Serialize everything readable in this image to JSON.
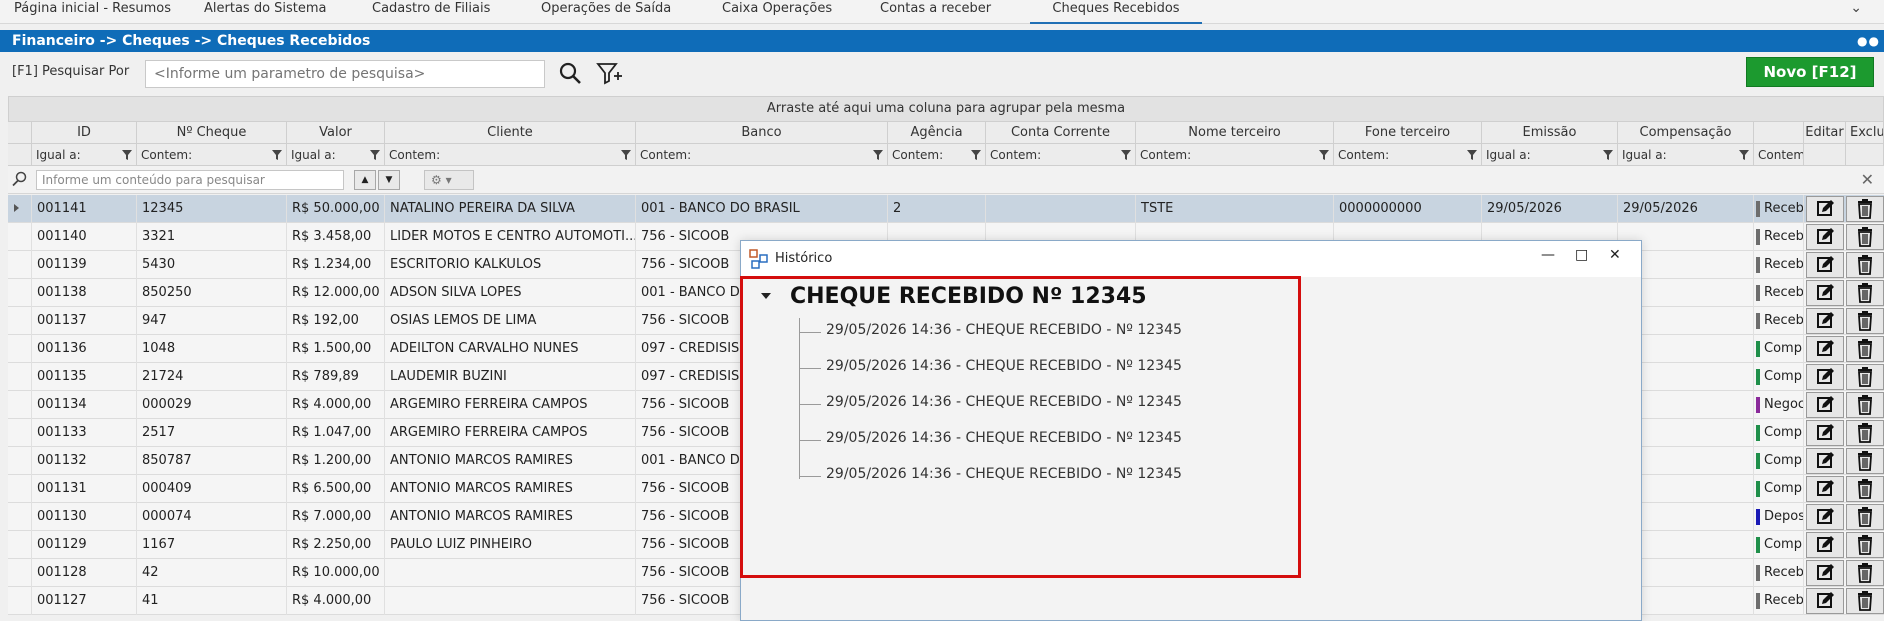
{
  "tabs": [
    {
      "label": "Página inicial - Resumos",
      "active": false
    },
    {
      "label": "Alertas do Sistema",
      "active": false
    },
    {
      "label": "Cadastro de Filiais",
      "active": false
    },
    {
      "label": "Operações de Saída",
      "active": false
    },
    {
      "label": "Caixa Operações",
      "active": false
    },
    {
      "label": "Contas a receber",
      "active": false
    },
    {
      "label": "Cheques Recebidos",
      "active": true
    }
  ],
  "breadcrumb": "Financeiro -> Cheques -> Cheques Recebidos",
  "search": {
    "label": "[F1] Pesquisar Por",
    "placeholder": "<Informe um parametro de pesquisa>"
  },
  "new_button": "Novo [F12]",
  "group_bar": "Arraste até aqui uma coluna para agrupar pela mesma",
  "columns": [
    "ID",
    "Nº Cheque",
    "Valor",
    "Cliente",
    "Banco",
    "Agência",
    "Conta Corrente",
    "Nome terceiro",
    "Fone terceiro",
    "Emissão",
    "Compensação",
    "",
    "Editar",
    "Excluir"
  ],
  "filters": [
    "Igual a:",
    "Contem:",
    "Igual a:",
    "Contem:",
    "Contem:",
    "Contem:",
    "Contem:",
    "Contem:",
    "Contem:",
    "Igual a:",
    "Igual a:",
    "Contem"
  ],
  "grid_search_placeholder": "Informe um conteúdo para pesquisar",
  "colors": {
    "accent": "#0f6cb8",
    "new_button": "#1c9a2f",
    "highlight": "#d40d0d",
    "status_gray": "#6d6d6d",
    "status_green": "#1f8f4a",
    "status_purple": "#8a2a9a",
    "status_blue": "#1a1ab5"
  },
  "rows": [
    {
      "id": "001141",
      "cheque": "12345",
      "valor": "R$ 50.000,00",
      "cliente": "NATALINO PEREIRA DA SILVA",
      "banco": "001 - BANCO DO BRASIL",
      "agencia": "2",
      "conta": "",
      "terceiro": "TSTE",
      "fone": "0000000000",
      "emissao": "29/05/2026",
      "compensacao": "29/05/2026",
      "situacao": "Receb",
      "status_color": "#6d6d6d",
      "selected": true
    },
    {
      "id": "001140",
      "cheque": "3321",
      "valor": "R$ 3.458,00",
      "cliente": "LIDER MOTOS E CENTRO AUTOMOTI...",
      "banco": "756 - SICOOB",
      "agencia": "",
      "conta": "",
      "terceiro": "",
      "fone": "",
      "emissao": "",
      "compensacao": "",
      "situacao": "Receb",
      "status_color": "#6d6d6d"
    },
    {
      "id": "001139",
      "cheque": "5430",
      "valor": "R$ 1.234,00",
      "cliente": "ESCRITORIO KALKULOS",
      "banco": "756 - SICOOB",
      "agencia": "",
      "conta": "",
      "terceiro": "",
      "fone": "",
      "emissao": "",
      "compensacao": "",
      "situacao": "Receb",
      "status_color": "#6d6d6d"
    },
    {
      "id": "001138",
      "cheque": "850250",
      "valor": "R$ 12.000,00",
      "cliente": "ADSON SILVA LOPES",
      "banco": "001 - BANCO DO",
      "agencia": "",
      "conta": "",
      "terceiro": "",
      "fone": "",
      "emissao": "",
      "compensacao": "",
      "situacao": "Receb",
      "status_color": "#6d6d6d"
    },
    {
      "id": "001137",
      "cheque": "947",
      "valor": "R$ 192,00",
      "cliente": "OSIAS LEMOS DE LIMA",
      "banco": "756 - SICOOB",
      "agencia": "",
      "conta": "",
      "terceiro": "",
      "fone": "",
      "emissao": "",
      "compensacao": "",
      "situacao": "Receb",
      "status_color": "#6d6d6d"
    },
    {
      "id": "001136",
      "cheque": "1048",
      "valor": "R$ 1.500,00",
      "cliente": "ADEILTON CARVALHO NUNES",
      "banco": "097 - CREDISIS",
      "agencia": "",
      "conta": "",
      "terceiro": "",
      "fone": "",
      "emissao": "",
      "compensacao": "",
      "situacao": "Comp",
      "status_color": "#1f8f4a"
    },
    {
      "id": "001135",
      "cheque": "21724",
      "valor": "R$ 789,89",
      "cliente": "LAUDEMIR BUZINI",
      "banco": "097 - CREDISIS",
      "agencia": "",
      "conta": "",
      "terceiro": "",
      "fone": "",
      "emissao": "",
      "compensacao": "",
      "situacao": "Comp",
      "status_color": "#1f8f4a"
    },
    {
      "id": "001134",
      "cheque": "000029",
      "valor": "R$ 4.000,00",
      "cliente": "ARGEMIRO FERREIRA CAMPOS",
      "banco": "756 - SICOOB",
      "agencia": "",
      "conta": "",
      "terceiro": "",
      "fone": "",
      "emissao": "",
      "compensacao": "",
      "situacao": "Negoc",
      "status_color": "#8a2a9a"
    },
    {
      "id": "001133",
      "cheque": "2517",
      "valor": "R$ 1.047,00",
      "cliente": "ARGEMIRO FERREIRA CAMPOS",
      "banco": "756 - SICOOB",
      "agencia": "",
      "conta": "",
      "terceiro": "",
      "fone": "",
      "emissao": "",
      "compensacao": "",
      "situacao": "Comp",
      "status_color": "#1f8f4a"
    },
    {
      "id": "001132",
      "cheque": "850787",
      "valor": "R$ 1.200,00",
      "cliente": "ANTONIO MARCOS RAMIRES",
      "banco": "001 - BANCO DO",
      "agencia": "",
      "conta": "",
      "terceiro": "",
      "fone": "",
      "emissao": "",
      "compensacao": "",
      "situacao": "Comp",
      "status_color": "#1f8f4a"
    },
    {
      "id": "001131",
      "cheque": "000409",
      "valor": "R$ 6.500,00",
      "cliente": "ANTONIO MARCOS RAMIRES",
      "banco": "756 - SICOOB",
      "agencia": "",
      "conta": "",
      "terceiro": "",
      "fone": "",
      "emissao": "",
      "compensacao": "",
      "situacao": "Comp",
      "status_color": "#1f8f4a"
    },
    {
      "id": "001130",
      "cheque": "000074",
      "valor": "R$ 7.000,00",
      "cliente": "ANTONIO MARCOS RAMIRES",
      "banco": "756 - SICOOB",
      "agencia": "",
      "conta": "",
      "terceiro": "",
      "fone": "",
      "emissao": "",
      "compensacao": "",
      "situacao": "Depos",
      "status_color": "#1a1ab5"
    },
    {
      "id": "001129",
      "cheque": "1167",
      "valor": "R$ 2.250,00",
      "cliente": "PAULO LUIZ PINHEIRO",
      "banco": "756 - SICOOB",
      "agencia": "",
      "conta": "",
      "terceiro": "",
      "fone": "",
      "emissao": "",
      "compensacao": "",
      "situacao": "Comp",
      "status_color": "#1f8f4a"
    },
    {
      "id": "001128",
      "cheque": "42",
      "valor": "R$ 10.000,00",
      "cliente": "",
      "banco": "756 - SICOOB",
      "agencia": "",
      "conta": "",
      "terceiro": "",
      "fone": "",
      "emissao": "",
      "compensacao": "",
      "situacao": "Receb",
      "status_color": "#6d6d6d"
    },
    {
      "id": "001127",
      "cheque": "41",
      "valor": "R$ 4.000,00",
      "cliente": "",
      "banco": "756 - SICOOB",
      "agencia": "",
      "conta": "",
      "terceiro": "",
      "fone": "",
      "emissao": "",
      "compensacao": "",
      "situacao": "Receb",
      "status_color": "#6d6d6d"
    }
  ],
  "modal": {
    "title": "Histórico",
    "tree_title": "CHEQUE RECEBIDO Nº 12345",
    "items": [
      "29/05/2026 14:36 - CHEQUE RECEBIDO - Nº 12345",
      "29/05/2026 14:36 - CHEQUE RECEBIDO - Nº 12345",
      "29/05/2026 14:36 - CHEQUE RECEBIDO - Nº 12345",
      "29/05/2026 14:36 - CHEQUE RECEBIDO - Nº 12345",
      "29/05/2026 14:36 - CHEQUE RECEBIDO - Nº 12345"
    ]
  }
}
